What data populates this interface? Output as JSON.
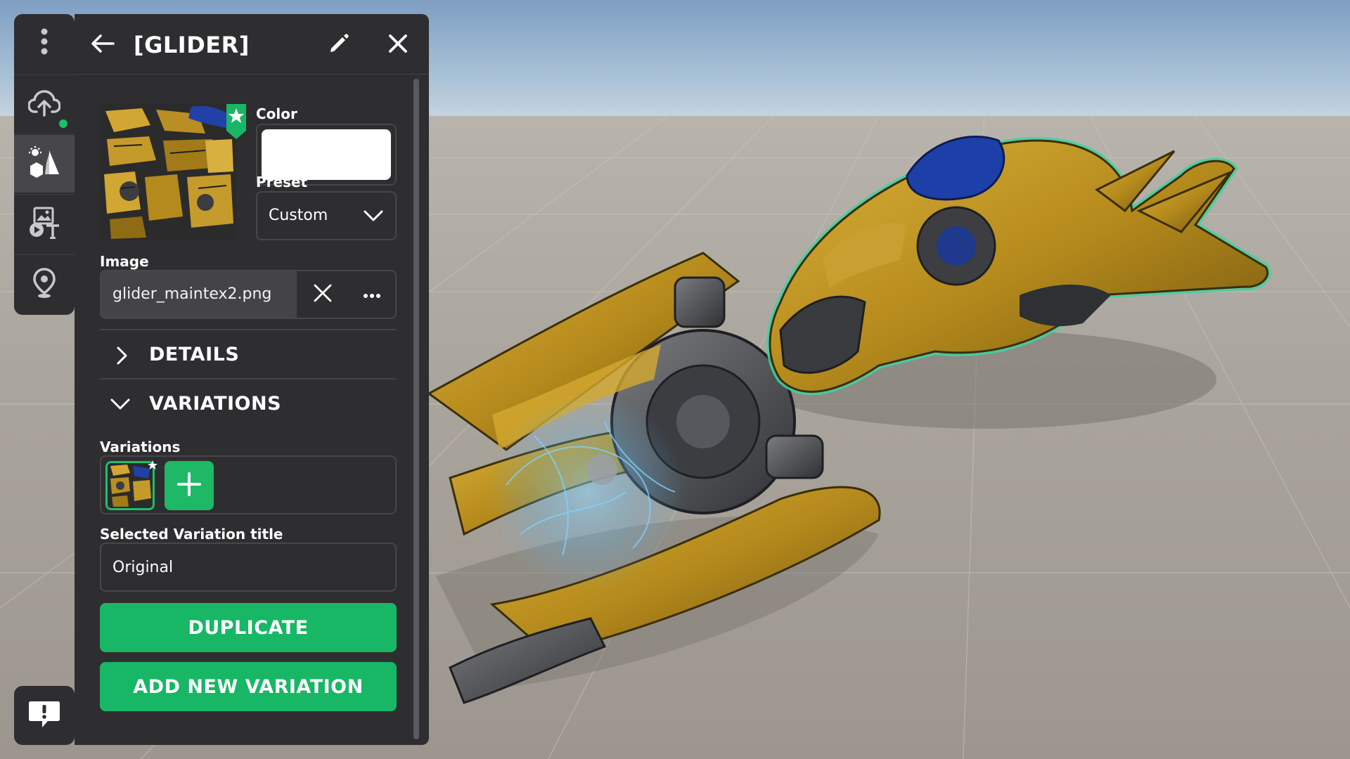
{
  "toolbar": {
    "items": [
      {
        "icon": "more-vertical-icon"
      },
      {
        "icon": "cloud-upload-icon",
        "status": "online"
      },
      {
        "icon": "objects-light-icon",
        "active": true
      },
      {
        "icon": "media-text-icon"
      },
      {
        "icon": "location-pin-icon"
      }
    ],
    "feedback_icon": "feedback-icon"
  },
  "panel": {
    "title": "[GLIDER]",
    "back_icon": "arrow-left-icon",
    "edit_icon": "pencil-icon",
    "close_icon": "close-icon",
    "color_label": "Color",
    "color_value": "#ffffff",
    "preset_label": "Preset",
    "preset_value": "Custom",
    "image_label": "Image",
    "image_file": "glider_maintex2.png",
    "details_title": "DETAILS",
    "variations_section_title": "VARIATIONS",
    "variations_label": "Variations",
    "selected_title_label": "Selected Variation title",
    "selected_title_value": "Original",
    "duplicate_label": "DUPLICATE",
    "add_variation_label": "ADD NEW VARIATION"
  },
  "colors": {
    "accent": "#17b765",
    "panel_bg": "#2e2e31",
    "field_border": "#47474b",
    "selection_outline": "#3fd1a0"
  }
}
